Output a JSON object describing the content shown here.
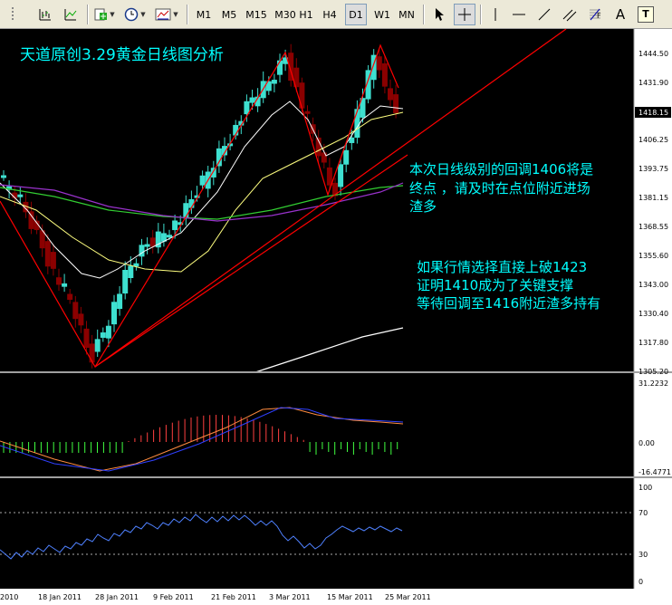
{
  "toolbar": {
    "timeframes": [
      "M1",
      "M5",
      "M15",
      "M30",
      "H1",
      "H4",
      "D1",
      "W1",
      "MN"
    ],
    "active_timeframe": "D1",
    "text_tool": "A",
    "label_tool": "T"
  },
  "chart": {
    "title": "天道原创3.29黄金日线图分析",
    "annotation1": [
      "本次日线级别的回调1406将是",
      "终点 ，请及时在点位附近进场",
      "渣多"
    ],
    "annotation2": [
      "如果行情选择直接上破1423",
      "证明1410成为了关键支撑",
      "等待回调至1416附近渣多持有"
    ],
    "price_ticks": [
      "1444.50",
      "1431.90",
      "1406.25",
      "1393.75",
      "1381.15",
      "1368.55",
      "1355.60",
      "1343.00",
      "1330.40",
      "1317.80",
      "1305.20"
    ],
    "current_price": "1418.15",
    "macd_ticks": [
      "31.2232",
      "0.00",
      "-16.4771"
    ],
    "rsi_ticks": [
      "100",
      "70",
      "30",
      "0"
    ],
    "date_labels": [
      "2010",
      "18 Jan 2011",
      "28 Jan 2011",
      "9 Feb 2011",
      "21 Feb 2011",
      "3 Mar 2011",
      "15 Mar 2011",
      "25 Mar 2011"
    ]
  },
  "colors": {
    "background": "#000000",
    "bull_candle": "#3ee0d0",
    "bear_candle": "#8b0000",
    "ma_white": "#ffffff",
    "ma_yellow": "#ffff80",
    "ma_green": "#32cd32",
    "ma_purple": "#9932cc",
    "trend_line": "#ff0000",
    "annotation": "#00ffff",
    "macd_pos": "#ff4040",
    "macd_neg": "#40ff40",
    "rsi": "#4f81ff"
  },
  "icons": [
    "chart-properties-icon",
    "period-icon",
    "new-order-icon",
    "clock-icon",
    "template-icon",
    "cursor-icon",
    "crosshair-icon",
    "vertical-line-icon",
    "horizontal-line-icon",
    "trendline-icon",
    "fibonacci-icon"
  ]
}
